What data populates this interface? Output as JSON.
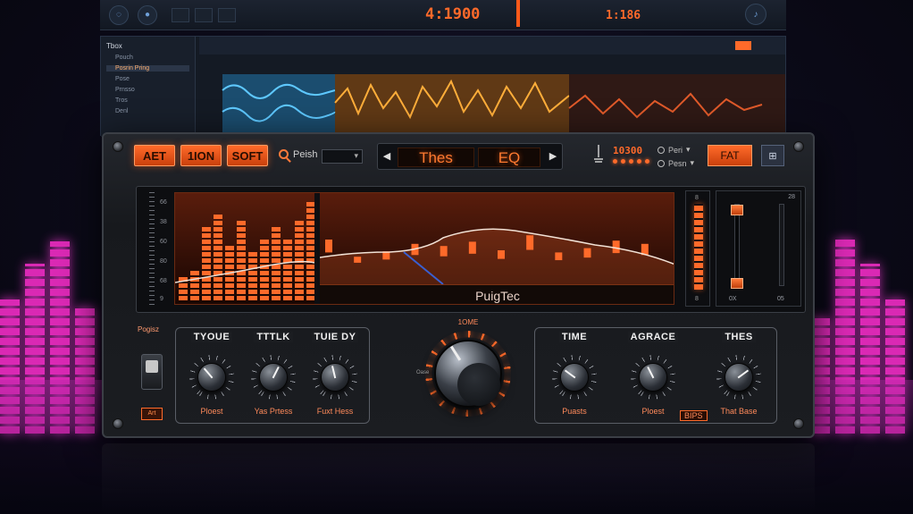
{
  "daw": {
    "tempo_display": "4:1900",
    "position_display": "1:186",
    "sidebar": {
      "title": "Tbox",
      "items": [
        "Pouch",
        "Posrin Pring",
        "Pose",
        "Prnsso",
        "Tros",
        "Denl"
      ]
    }
  },
  "plugin": {
    "buttons": [
      {
        "label": "AET"
      },
      {
        "label": "1ION"
      },
      {
        "label": "SOFT"
      }
    ],
    "search_label": "Peish",
    "preset_bar": {
      "left": "Thes",
      "right": "EQ"
    },
    "readout": "10300",
    "radio_options": [
      "Peri",
      "Pesn"
    ],
    "fat_button": "FAT",
    "grid_icon_label": "⊞",
    "display_name": "PuigTec",
    "scale_labels": [
      "66",
      "38",
      "60",
      "80",
      "68",
      "9"
    ],
    "side_meter": {
      "top": "8",
      "bottom": "8"
    },
    "fader_labels": {
      "top": "28",
      "left_bottom": "0X",
      "right_bottom": "05"
    },
    "side_label": "Pogisz",
    "mini_button": "Art",
    "knob_groups": [
      {
        "knobs": [
          {
            "title": "TYOUE",
            "label": "Ploest",
            "value": 0.35
          },
          {
            "title": "TTTLK",
            "label": "Yas Prtess",
            "value": 0.6
          },
          {
            "title": "TUIE DY",
            "label": "Fuxt Hess",
            "value": 0.45
          }
        ]
      },
      {
        "knobs": [
          {
            "title": "TIME",
            "label": "Puasts",
            "value": 0.3
          },
          {
            "title": "AGRACE",
            "label": "Ploest",
            "value": 0.4,
            "boxed": "BIPS"
          },
          {
            "title": "THES",
            "label": "That Base",
            "value": 0.7
          }
        ]
      }
    ],
    "big_knob": {
      "title": "1OME",
      "min_label": "Oase",
      "value": 0.38
    }
  },
  "chart_data": {
    "type": "bar",
    "left_bars": [
      18,
      27,
      70,
      82,
      48,
      72,
      46,
      58,
      66,
      54,
      76,
      90
    ],
    "right_peaks": [
      60,
      28,
      38,
      52,
      48,
      56,
      40,
      68,
      36,
      44,
      58,
      52
    ],
    "accent_color": "#ff6a2a"
  },
  "colors": {
    "accent": "#ff6a2a",
    "panel": "#1b1d21",
    "background": "#0b0a18",
    "neon": "#ff2fd0"
  }
}
